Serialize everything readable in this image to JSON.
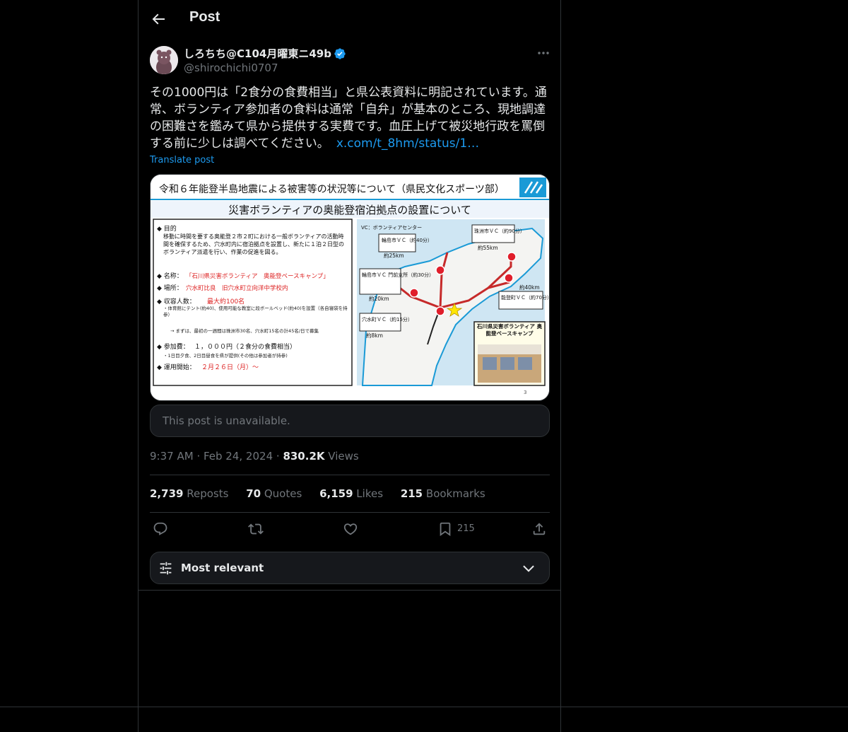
{
  "header": {
    "title": "Post"
  },
  "author": {
    "name": "しろちち@C104月曜東ニ49b",
    "handle": "@shirochichi0707"
  },
  "post": {
    "text": "その1000円は「2食分の食費相当」と県公表資料に明記されています。通常、ボランティア参加者の食料は通常「自弁」が基本のところ、現地調達の困難さを鑑みて県から提供する実費です。血圧上げて被災地行政を罵倒する前に少しは調べてください。",
    "link": "x.com/t_8hm/status/1…",
    "translate": "Translate post",
    "time": "9:37 AM",
    "date": "Feb 24, 2024",
    "views_count": "830.2K",
    "views_label": "Views"
  },
  "slide": {
    "header": "令和６年能登半島地震による被害等の状況等について（県民文化スポーツ部）",
    "title": "災害ボランティアの奥能登宿泊拠点の設置について",
    "purpose_label": "◆ 目的",
    "purpose_text": "移動に時間を要する奥能登２市２町における一般ボランティアの活動時間を確保するため、穴水町内に宿泊拠点を設置し、新たに１泊２日型のボランティア派遣を行い、作業の促進を図る。",
    "name_label": "◆ 名称：",
    "name_value": "「石川県災害ボランティア　奥能登ベースキャンプ」",
    "place_label": "◆ 場所：",
    "place_value": "穴水町比良　旧穴水町立向洋中学校内",
    "capacity_label": "◆ 収容人数：",
    "capacity_value": "最大約100名",
    "capacity_note1": "・体育館にテント(約40)、使用可能な教室に段ボールベッド(約40)を設置（各自寝袋を持参）",
    "capacity_note2": "→ まずは、最初の一週間は珠洲市30名、穴水町15名の計45名/日で募集",
    "fee_label": "◆ 参加費：",
    "fee_value": "１，０００円（２食分の食費相当）",
    "fee_note": "・1日目夕食、2日目昼食を県が提供(その他は参加者が持参)",
    "start_label": "◆ 運用開始：",
    "start_value": "２月２６日（月）～",
    "map_legend": "VC：ボランティアセンター",
    "vc_wajima": "輪島市ＶＣ（約40分）",
    "dist_wajima": "約25km",
    "vc_suzu": "珠洲市ＶＣ（約90分）",
    "dist_suzu": "約55km",
    "vc_monzen": "輪島市ＶＣ 門前支所（約30分）",
    "dist_monzen": "約20km",
    "vc_noto": "能登町ＶＣ（約70分）",
    "dist_noto": "約40km",
    "vc_anamizu": "穴水町ＶＣ（約15分）",
    "dist_anamizu": "約8km",
    "camp_label": "石川県災害ボランティア 奥能登ベースキャンプ",
    "page_num": "3"
  },
  "quote": {
    "unavailable": "This post is unavailable."
  },
  "stats": {
    "reposts_count": "2,739",
    "reposts_label": "Reposts",
    "quotes_count": "70",
    "quotes_label": "Quotes",
    "likes_count": "6,159",
    "likes_label": "Likes",
    "bookmarks_count": "215",
    "bookmarks_label": "Bookmarks"
  },
  "actions": {
    "bookmark_count": "215"
  },
  "sort": {
    "label": "Most relevant"
  },
  "colors": {
    "accent": "#1d9bf0",
    "background": "#000000",
    "border": "#2f3336",
    "muted": "#71767b"
  }
}
